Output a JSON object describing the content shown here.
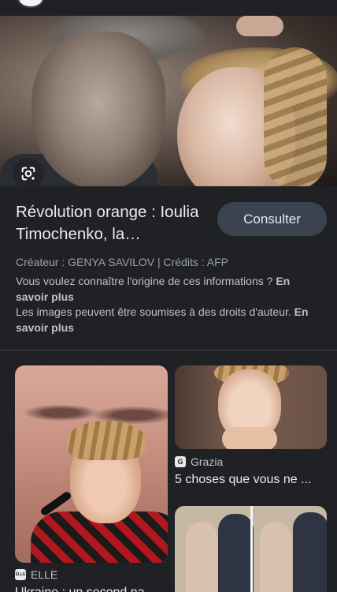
{
  "result": {
    "title": "Révolution orange : Ioulia Timochenko, la…",
    "action_label": "Consulter",
    "credits": "Créateur : GENYA SAVILOV | Crédits : AFP",
    "info_origin": "Vous voulez connaître l'origine de ces informations ?",
    "info_origin_link": "En savoir plus",
    "info_rights": "Les images peuvent être soumises à des droits d'auteur.",
    "info_rights_link": "En savoir plus"
  },
  "related": [
    {
      "source": "ELLE",
      "source_icon": "ELLE",
      "title": "Ukraine : un second na..."
    },
    {
      "source": "Grazia",
      "source_icon": "G",
      "title": "5 choses que vous ne ..."
    }
  ],
  "icons": {
    "lens": "google-lens-icon",
    "profile": "account-avatar-icon"
  },
  "colors": {
    "background": "#202124",
    "button": "#3c4350",
    "text": "#e8eaed",
    "muted": "#9aa0a6"
  }
}
